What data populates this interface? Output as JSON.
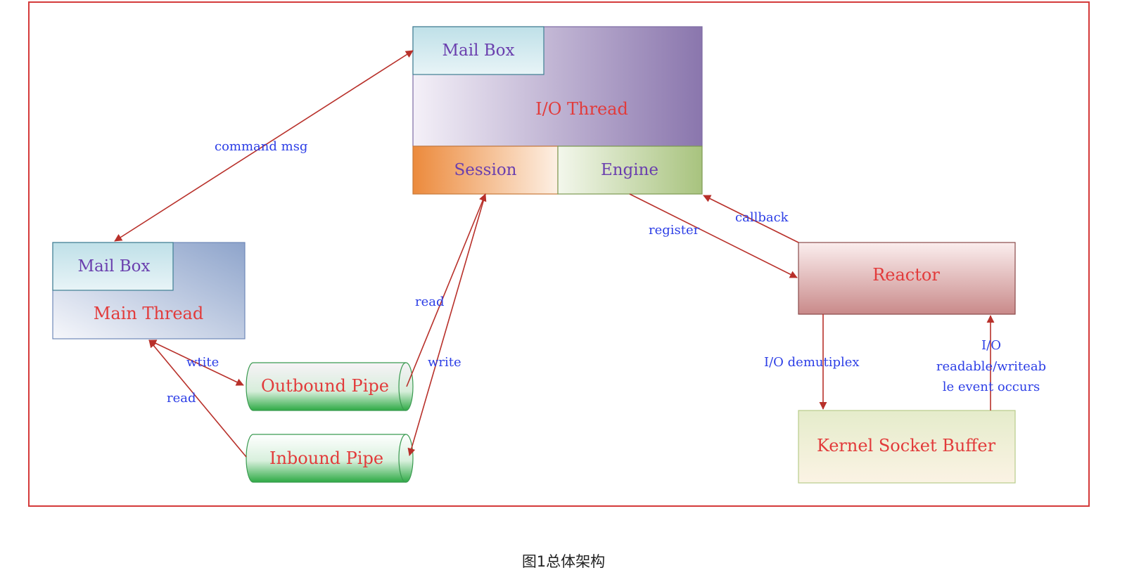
{
  "caption": "图1总体架构",
  "io_thread": {
    "mailbox": "Mail Box",
    "title": "I/O Thread",
    "session": "Session",
    "engine": "Engine"
  },
  "main_thread": {
    "mailbox": "Mail Box",
    "title": "Main Thread"
  },
  "outbound_pipe": "Outbound Pipe",
  "inbound_pipe": "Inbound Pipe",
  "reactor": "Reactor",
  "kernel_socket_buffer": "Kernel Socket Buffer",
  "edge_labels": {
    "command_msg": "command msg",
    "read_io": "read",
    "write_io": "write",
    "wtite_main": "wtite",
    "read_main": "read",
    "register": "register",
    "callback": "callback",
    "io_demutiplex": "I/O demutiplex",
    "io_event_line1": "I/O",
    "io_event_line2": "readable/writeab",
    "io_event_line3": "le event occurs"
  },
  "colors": {
    "frame": "#d43a3a",
    "arrow": "#b8302a",
    "label_red": "#e23b3b",
    "label_blue": "#2c3ee6",
    "label_purple": "#6a3fae"
  }
}
